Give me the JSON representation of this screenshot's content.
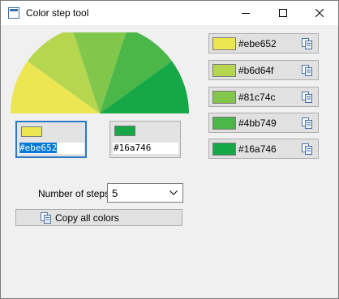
{
  "window": {
    "title": "Color step tool"
  },
  "pickers": [
    {
      "hex": "#ebe652",
      "color": "#ebe652"
    },
    {
      "hex": "#16a746",
      "color": "#16a746"
    }
  ],
  "steps": {
    "label": "Number of steps",
    "value": "5"
  },
  "copy_all_label": "Copy all colors",
  "colors": [
    {
      "hex": "#ebe652"
    },
    {
      "hex": "#b6d64f"
    },
    {
      "hex": "#81c74c"
    },
    {
      "hex": "#4bb749"
    },
    {
      "hex": "#16a746"
    }
  ]
}
